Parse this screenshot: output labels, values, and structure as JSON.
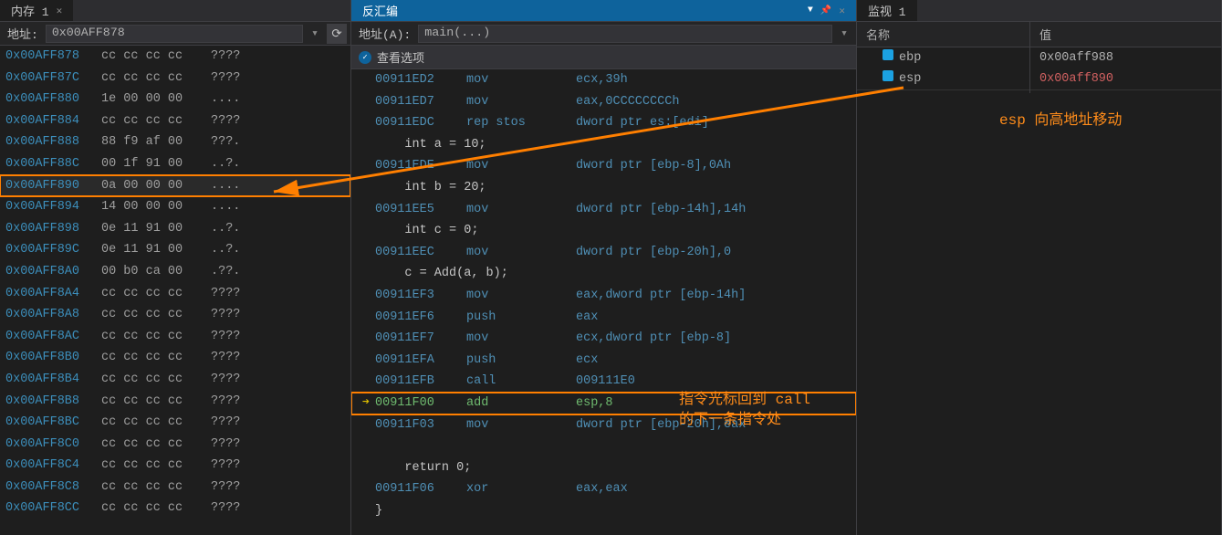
{
  "memory": {
    "tab_label": "内存 1",
    "addr_label": "地址:",
    "addr_value": "0x00AFF878",
    "rows": [
      {
        "addr": "0x00AFF878",
        "bytes": "cc cc cc cc",
        "ascii": "????"
      },
      {
        "addr": "0x00AFF87C",
        "bytes": "cc cc cc cc",
        "ascii": "????"
      },
      {
        "addr": "0x00AFF880",
        "bytes": "1e 00 00 00",
        "ascii": "...."
      },
      {
        "addr": "0x00AFF884",
        "bytes": "cc cc cc cc",
        "ascii": "????"
      },
      {
        "addr": "0x00AFF888",
        "bytes": "88 f9 af 00",
        "ascii": "???."
      },
      {
        "addr": "0x00AFF88C",
        "bytes": "00 1f 91 00",
        "ascii": "..?."
      },
      {
        "addr": "0x00AFF890",
        "bytes": "0a 00 00 00",
        "ascii": "....",
        "hl": true
      },
      {
        "addr": "0x00AFF894",
        "bytes": "14 00 00 00",
        "ascii": "...."
      },
      {
        "addr": "0x00AFF898",
        "bytes": "0e 11 91 00",
        "ascii": "..?."
      },
      {
        "addr": "0x00AFF89C",
        "bytes": "0e 11 91 00",
        "ascii": "..?."
      },
      {
        "addr": "0x00AFF8A0",
        "bytes": "00 b0 ca 00",
        "ascii": ".??."
      },
      {
        "addr": "0x00AFF8A4",
        "bytes": "cc cc cc cc",
        "ascii": "????"
      },
      {
        "addr": "0x00AFF8A8",
        "bytes": "cc cc cc cc",
        "ascii": "????"
      },
      {
        "addr": "0x00AFF8AC",
        "bytes": "cc cc cc cc",
        "ascii": "????"
      },
      {
        "addr": "0x00AFF8B0",
        "bytes": "cc cc cc cc",
        "ascii": "????"
      },
      {
        "addr": "0x00AFF8B4",
        "bytes": "cc cc cc cc",
        "ascii": "????"
      },
      {
        "addr": "0x00AFF8B8",
        "bytes": "cc cc cc cc",
        "ascii": "????"
      },
      {
        "addr": "0x00AFF8BC",
        "bytes": "cc cc cc cc",
        "ascii": "????"
      },
      {
        "addr": "0x00AFF8C0",
        "bytes": "cc cc cc cc",
        "ascii": "????"
      },
      {
        "addr": "0x00AFF8C4",
        "bytes": "cc cc cc cc",
        "ascii": "????"
      },
      {
        "addr": "0x00AFF8C8",
        "bytes": "cc cc cc cc",
        "ascii": "????"
      },
      {
        "addr": "0x00AFF8CC",
        "bytes": "cc cc cc cc",
        "ascii": "????"
      }
    ]
  },
  "disasm": {
    "tab_label": "反汇编",
    "addr_label": "地址(A):",
    "addr_value": "main(...)",
    "options_label": "查看选项",
    "rows": [
      {
        "addr": "00911ED2",
        "mn": "mov",
        "ops": "ecx,39h"
      },
      {
        "addr": "00911ED7",
        "mn": "mov",
        "ops": "eax,0CCCCCCCCh"
      },
      {
        "addr": "00911EDC",
        "mn": "rep stos",
        "ops": "dword ptr es:[edi]"
      },
      {
        "src": "    int a = 10;"
      },
      {
        "addr": "00911EDE",
        "mn": "mov",
        "ops": "dword ptr [ebp-8],0Ah"
      },
      {
        "src": "    int b = 20;"
      },
      {
        "addr": "00911EE5",
        "mn": "mov",
        "ops": "dword ptr [ebp-14h],14h"
      },
      {
        "src": "    int c = 0;"
      },
      {
        "addr": "00911EEC",
        "mn": "mov",
        "ops": "dword ptr [ebp-20h],0"
      },
      {
        "src": "    c = Add(a, b);"
      },
      {
        "addr": "00911EF3",
        "mn": "mov",
        "ops": "eax,dword ptr [ebp-14h]"
      },
      {
        "addr": "00911EF6",
        "mn": "push",
        "ops": "eax"
      },
      {
        "addr": "00911EF7",
        "mn": "mov",
        "ops": "ecx,dword ptr [ebp-8]"
      },
      {
        "addr": "00911EFA",
        "mn": "push",
        "ops": "ecx"
      },
      {
        "addr": "00911EFB",
        "mn": "call",
        "ops": "009111E0"
      },
      {
        "addr": "00911F00",
        "mn": "add",
        "ops": "esp,8",
        "current": true,
        "boxed": true
      },
      {
        "addr": "00911F03",
        "mn": "mov",
        "ops": "dword ptr [ebp-20h],eax"
      },
      {
        "src": " "
      },
      {
        "src": "    return 0;"
      },
      {
        "addr": "00911F06",
        "mn": "xor",
        "ops": "eax,eax"
      },
      {
        "src": "}"
      }
    ]
  },
  "watch": {
    "tab_label": "监视 1",
    "col_name": "名称",
    "col_value": "值",
    "rows": [
      {
        "name": "ebp",
        "value": "0x00aff988"
      },
      {
        "name": "esp",
        "value": "0x00aff890",
        "changed": true
      }
    ]
  },
  "annotations": {
    "a1": "esp 向高地址移动",
    "a2_l1": "指令光标回到 call",
    "a2_l2": "的下一条指令处"
  }
}
